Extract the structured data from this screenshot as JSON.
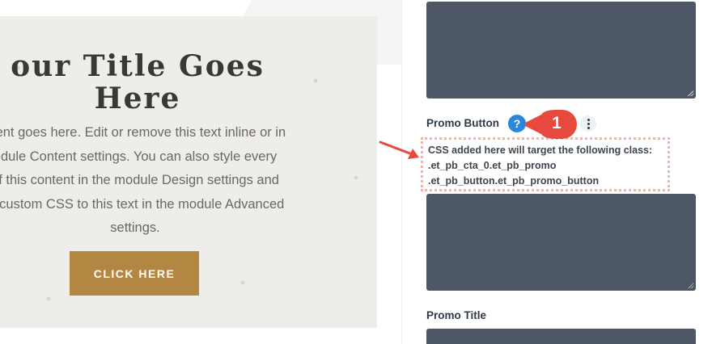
{
  "preview": {
    "title_line1": "our Title Goes",
    "title_line2": "Here",
    "body_lines": [
      "ntent goes here. Edit or remove this text inline or in",
      "odule Content settings. You can also style every",
      "of this content in the module Design settings and",
      "ly custom CSS to this text in the module Advanced",
      "settings."
    ],
    "button_label": "CLICK HERE"
  },
  "panel": {
    "promo_button_label": "Promo Button",
    "help_icon_glyph": "?",
    "badge_number": "1",
    "help_lines": [
      "CSS added here will target the following class:",
      ".et_pb_cta_0.et_pb_promo",
      ".et_pb_button.et_pb_promo_button"
    ],
    "promo_title_label": "Promo Title"
  },
  "colors": {
    "button_bg": "#b38641",
    "css_box_bg": "#4d5766",
    "help_icon": "#2b87da",
    "badge_red": "#e8493f",
    "dotted_border": "#f3b2ae"
  }
}
